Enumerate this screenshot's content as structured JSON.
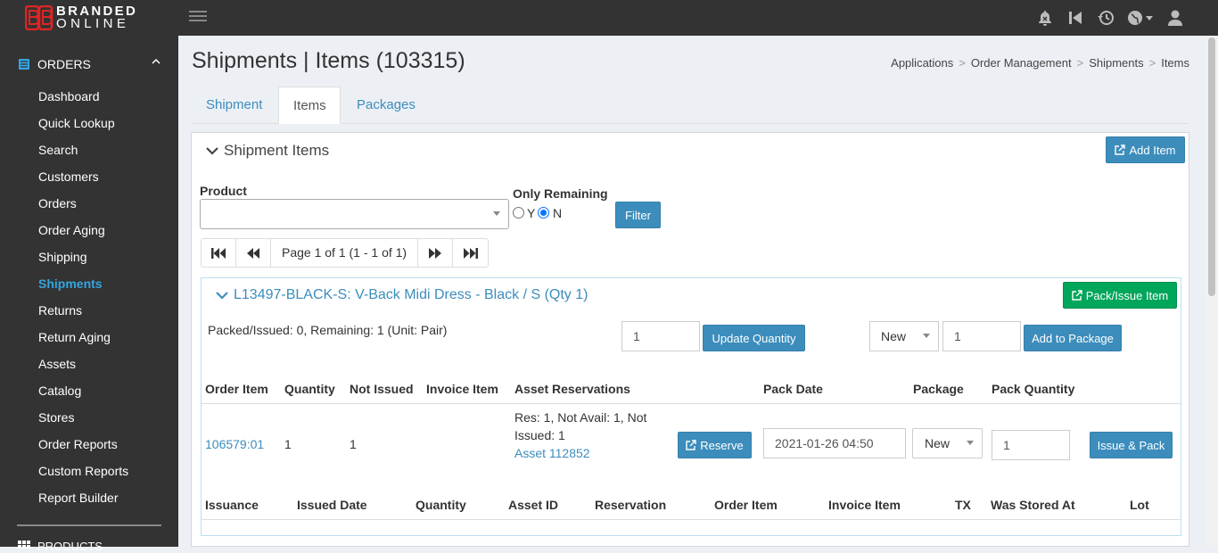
{
  "brand": {
    "line1": "BRANDED",
    "line2": "ONLINE",
    "color": "#e02424"
  },
  "sidebar": {
    "section": "ORDERS",
    "items": [
      {
        "label": "Dashboard"
      },
      {
        "label": "Quick Lookup"
      },
      {
        "label": "Search"
      },
      {
        "label": "Customers"
      },
      {
        "label": "Orders"
      },
      {
        "label": "Order Aging"
      },
      {
        "label": "Shipping"
      },
      {
        "label": "Shipments",
        "active": true
      },
      {
        "label": "Returns"
      },
      {
        "label": "Return Aging"
      },
      {
        "label": "Assets"
      },
      {
        "label": "Catalog"
      },
      {
        "label": "Stores"
      },
      {
        "label": "Order Reports"
      },
      {
        "label": "Custom Reports"
      },
      {
        "label": "Report Builder"
      }
    ],
    "next_section": "PRODUCTS"
  },
  "page": {
    "title": "Shipments | Items (103315)",
    "breadcrumb": [
      "Applications",
      "Order Management",
      "Shipments",
      "Items"
    ]
  },
  "tabs": [
    {
      "label": "Shipment"
    },
    {
      "label": "Items",
      "active": true
    },
    {
      "label": "Packages"
    }
  ],
  "panel": {
    "title": "Shipment Items",
    "add_item": "Add Item",
    "product_label": "Product",
    "product_value": "",
    "only_remaining_label": "Only Remaining",
    "radio_y": "Y",
    "radio_n": "N",
    "radio_selected": "N",
    "filter": "Filter",
    "pager_text": "Page 1 of 1 (1 - 1 of 1)"
  },
  "item": {
    "title": "L13497-BLACK-S: V-Back Midi Dress - Black / S (Qty 1)",
    "pack_issue": "Pack/Issue Item",
    "status_text": "Packed/Issued: 0, Remaining: 1 (Unit: Pair)",
    "quantity_value": "1",
    "update_quantity": "Update Quantity",
    "package_select": "New",
    "package_qty": "1",
    "add_to_package": "Add to Package",
    "columns": [
      "Order Item",
      "Quantity",
      "Not Issued",
      "Invoice Item",
      "Asset Reservations",
      "Pack Date",
      "Package",
      "Pack Quantity"
    ],
    "row": {
      "order_item": "106579:01",
      "quantity": "1",
      "not_issued": "1",
      "invoice_item": "",
      "reservation_line1": "Res: 1, Not Avail: 1, Not",
      "reservation_line2": "Issued: 1",
      "asset_link": "Asset 112852",
      "reserve": "Reserve",
      "pack_date": "2021-01-26 04:50",
      "package": "New",
      "pack_qty": "1",
      "issue_pack": "Issue & Pack"
    },
    "issuance_columns": [
      "Issuance",
      "Issued Date",
      "Quantity",
      "Asset ID",
      "Reservation",
      "Order Item",
      "Invoice Item",
      "TX",
      "Was Stored At",
      "Lot"
    ]
  }
}
